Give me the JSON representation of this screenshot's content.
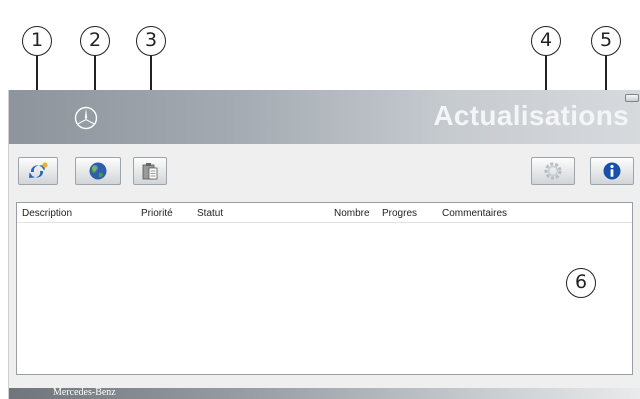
{
  "window": {
    "title": "Actualisations",
    "brand_footer": "Mercedes-Benz"
  },
  "toolbar": {
    "buttons": [
      {
        "name": "refresh-button",
        "icon": "refresh-icon"
      },
      {
        "name": "globe-button",
        "icon": "globe-icon"
      },
      {
        "name": "clipboard-button",
        "icon": "clipboard-icon"
      },
      {
        "name": "settings-button",
        "icon": "gear-icon"
      },
      {
        "name": "info-button",
        "icon": "info-icon"
      }
    ]
  },
  "list": {
    "columns": [
      "Description",
      "Priorité",
      "Statut",
      "Nombre",
      "Progres",
      "Commentaires"
    ],
    "rows": []
  },
  "callouts": [
    "1",
    "2",
    "3",
    "4",
    "5",
    "6"
  ],
  "colors": {
    "banner": "#a3aab1",
    "refresh_blue": "#2a63b8",
    "refresh_yellow": "#e8b52a",
    "info_blue": "#1650a8"
  }
}
